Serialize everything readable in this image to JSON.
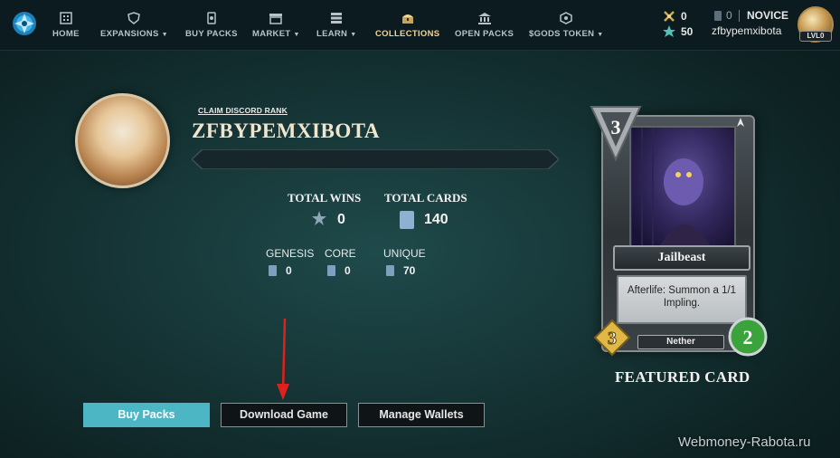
{
  "nav": {
    "items": [
      {
        "label": "HOME",
        "icon": "home-icon",
        "dropdown": false,
        "active": false
      },
      {
        "label": "EXPANSIONS",
        "icon": "shield-icon",
        "dropdown": true,
        "active": false
      },
      {
        "label": "BUY PACKS",
        "icon": "pack-icon",
        "dropdown": false,
        "active": false
      },
      {
        "label": "MARKET",
        "icon": "store-icon",
        "dropdown": true,
        "active": false
      },
      {
        "label": "LEARN",
        "icon": "book-icon",
        "dropdown": true,
        "active": false
      },
      {
        "label": "COLLECTIONS",
        "icon": "chest-icon",
        "dropdown": false,
        "active": true
      },
      {
        "label": "OPEN PACKS",
        "icon": "bank-icon",
        "dropdown": false,
        "active": false
      },
      {
        "label": "$GODS TOKEN",
        "icon": "token-icon",
        "dropdown": true,
        "active": false
      }
    ],
    "flux": "0",
    "stars": "50",
    "cards_count": "0",
    "rank": "NOVICE",
    "username": "zfbypemxibota",
    "level": "LVL0"
  },
  "profile": {
    "claim_label": "CLAIM DISCORD RANK",
    "name": "ZFBYPEMXIBOTA",
    "total_wins_label": "TOTAL WINS",
    "total_wins": "0",
    "total_cards_label": "TOTAL CARDS",
    "total_cards": "140",
    "genesis_label": "GENESIS",
    "genesis": "0",
    "core_label": "CORE",
    "core": "0",
    "unique_label": "UNIQUE",
    "unique": "70"
  },
  "featured": {
    "mana": "3",
    "name": "Jailbeast",
    "text": "Afterlife: Summon a 1/1 Impling.",
    "tribe": "Nether",
    "attack": "3",
    "health": "2",
    "label": "FEATURED CARD"
  },
  "buttons": {
    "buy_packs": "Buy Packs",
    "download_game": "Download Game",
    "manage_wallets": "Manage Wallets"
  },
  "watermark": "Webmoney-Rabota.ru",
  "colors": {
    "accent": "#4db6c4",
    "active_nav": "#f0d79a",
    "nav_bg": "#0c1b1f"
  }
}
